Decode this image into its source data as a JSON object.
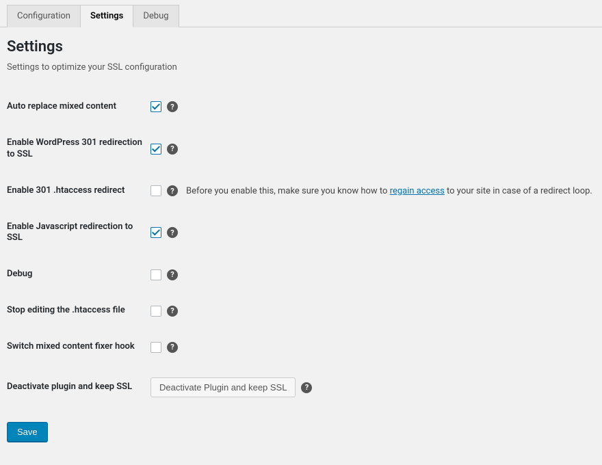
{
  "tabs": [
    {
      "label": "Configuration",
      "active": false
    },
    {
      "label": "Settings",
      "active": true
    },
    {
      "label": "Debug",
      "active": false
    }
  ],
  "page": {
    "title": "Settings",
    "description": "Settings to optimize your SSL configuration"
  },
  "settings": {
    "auto_replace_mixed": {
      "label": "Auto replace mixed content",
      "checked": true
    },
    "enable_wp_301": {
      "label": "Enable WordPress 301 redirection to SSL",
      "checked": true
    },
    "enable_htaccess_301": {
      "label": "Enable 301 .htaccess redirect",
      "checked": false,
      "note_before": "Before you enable this, make sure you know how to ",
      "note_link": "regain access",
      "note_after": " to your site in case of a redirect loop."
    },
    "enable_js_redirect": {
      "label": "Enable Javascript redirection to SSL",
      "checked": true
    },
    "debug": {
      "label": "Debug",
      "checked": false
    },
    "stop_htaccess": {
      "label": "Stop editing the .htaccess file",
      "checked": false
    },
    "switch_hook": {
      "label": "Switch mixed content fixer hook",
      "checked": false
    },
    "deactivate": {
      "label": "Deactivate plugin and keep SSL",
      "button": "Deactivate Plugin and keep SSL"
    }
  },
  "buttons": {
    "save": "Save"
  }
}
